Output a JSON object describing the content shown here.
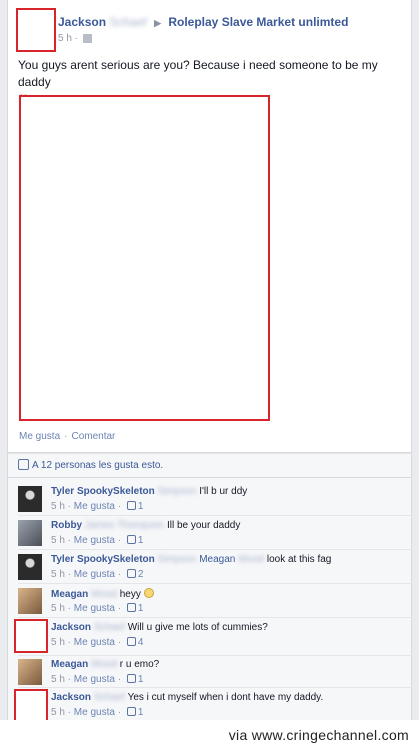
{
  "post": {
    "author": "Jackson",
    "author_blur": "Schaef",
    "group": "Roleplay Slave Market unlimted",
    "time": "5 h",
    "body": "You guys arent serious are you? Because i need someone to be my daddy",
    "heart": "♡",
    "action_like": "Me gusta",
    "action_comment": "Comentar",
    "likes_text": "A 12 personas les gusta esto."
  },
  "comments": [
    {
      "name": "Tyler SpookySkeleton",
      "blur": "Simpson",
      "text": "I'll b ur ddy",
      "time": "5 h",
      "like": "Me gusta",
      "count": "1"
    },
    {
      "name": "Robby",
      "blur": "James Thompson",
      "text": "Ill be your daddy",
      "time": "5 h",
      "like": "Me gusta",
      "count": "1"
    },
    {
      "name": "Tyler SpookySkeleton",
      "blur": "Simpson",
      "tag": "Meagan",
      "tag_blur": "Wood",
      "text": "look at this fag",
      "time": "5 h",
      "like": "Me gusta",
      "count": "2"
    },
    {
      "name": "Meagan",
      "blur": "Wood",
      "text": "heyy",
      "time": "5 h",
      "like": "Me gusta",
      "count": "1"
    },
    {
      "name": "Jackson",
      "blur": "Schaef",
      "text": "Will u give me lots of cummies?",
      "time": "5 h",
      "like": "Me gusta",
      "count": "4"
    },
    {
      "name": "Meagan",
      "blur": "Wood",
      "text": "r u emo?",
      "time": "5 h",
      "like": "Me gusta",
      "count": "1"
    },
    {
      "name": "Jackson",
      "blur": "Schaef",
      "text": "Yes i cut myself when i dont have my daddy.",
      "time": "5 h",
      "like": "Me gusta",
      "count": "1"
    }
  ],
  "watermark": "via www.cringechannel.com"
}
